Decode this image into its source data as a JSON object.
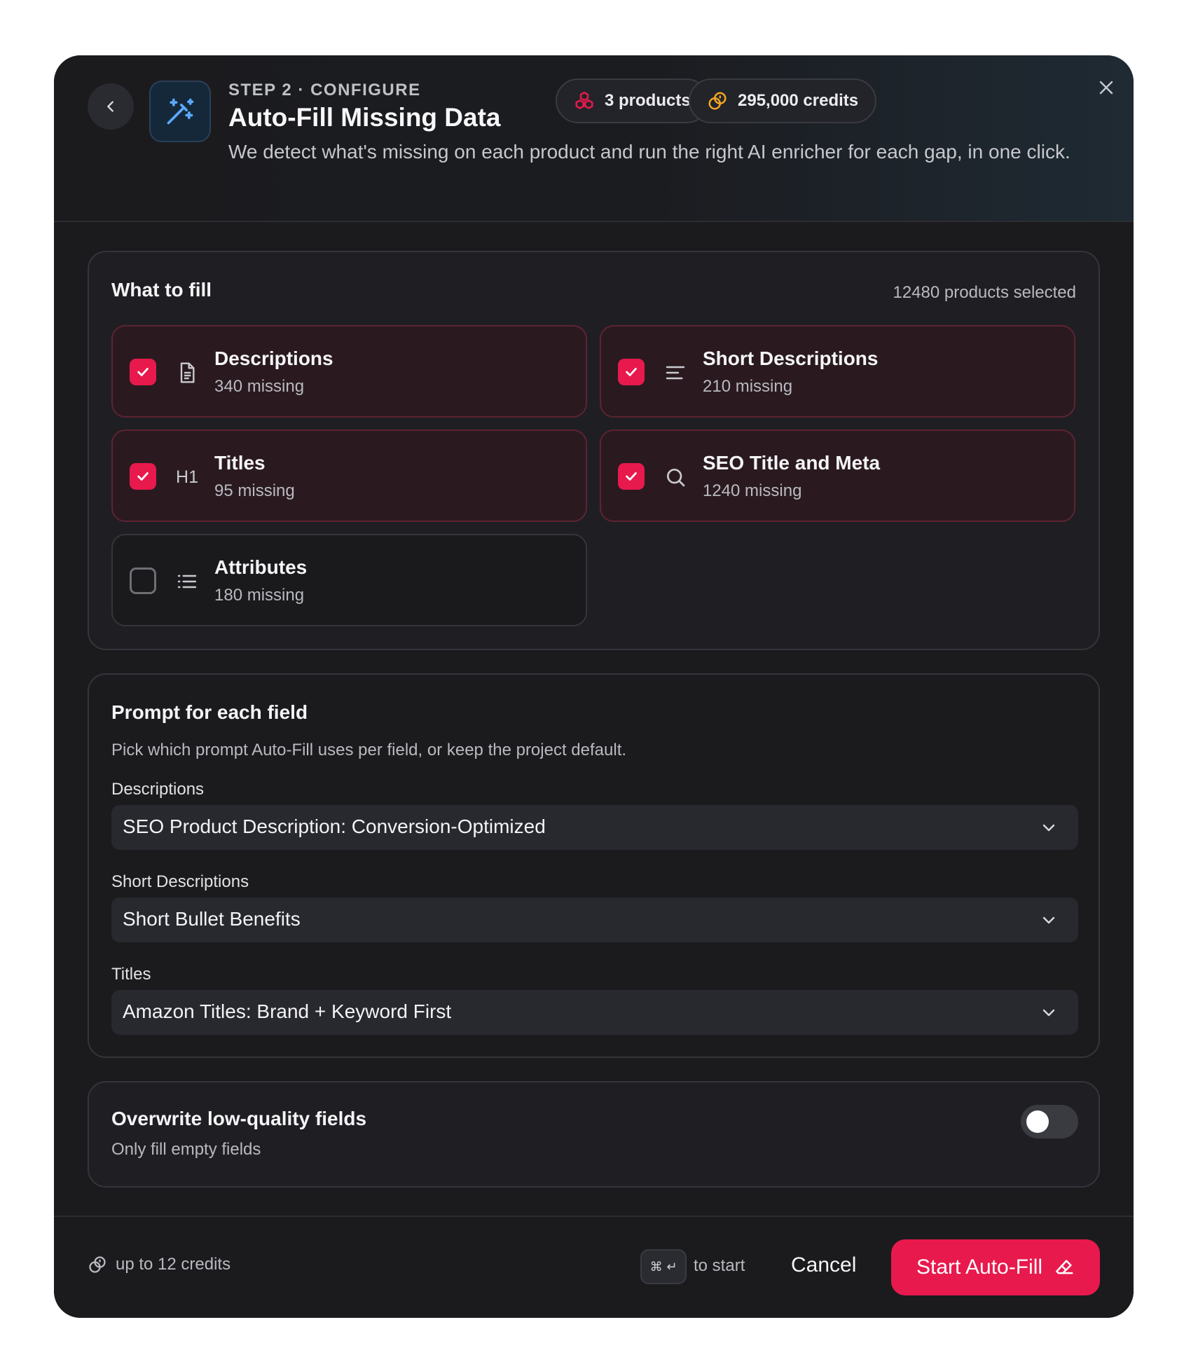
{
  "header": {
    "step": "STEP 2 · CONFIGURE",
    "title": "Auto-Fill Missing Data",
    "subtitle": "We detect what's missing on each product and run the right AI enricher for each gap, in one click.",
    "products_pill": "3 products",
    "credits_pill": "295,000 credits",
    "icons": {
      "back": "chevron-left-icon",
      "app": "magic-wand-icon",
      "products": "boxes-icon",
      "credits": "coins-icon",
      "close": "close-icon"
    }
  },
  "fill": {
    "title": "What to fill",
    "selected_count": "12480 products selected",
    "options": [
      {
        "label": "Descriptions",
        "missing": "340 missing",
        "checked": true,
        "icon": "document-icon"
      },
      {
        "label": "Short Descriptions",
        "missing": "210 missing",
        "checked": true,
        "icon": "align-left-icon"
      },
      {
        "label": "Titles",
        "missing": "95 missing",
        "checked": true,
        "icon": "heading-icon",
        "icon_text": "H1"
      },
      {
        "label": "SEO Title and Meta",
        "missing": "1240 missing",
        "checked": true,
        "icon": "search-icon"
      },
      {
        "label": "Attributes",
        "missing": "180 missing",
        "checked": false,
        "icon": "list-icon"
      }
    ]
  },
  "prompt": {
    "title": "Prompt for each field",
    "description": "Pick which prompt Auto-Fill uses per field, or keep the project default.",
    "fields": [
      {
        "label": "Descriptions",
        "value": "SEO Product Description: Conversion-Optimized"
      },
      {
        "label": "Short Descriptions",
        "value": "Short Bullet Benefits"
      },
      {
        "label": "Titles",
        "value": "Amazon Titles: Brand + Keyword First"
      }
    ]
  },
  "overwrite": {
    "title": "Overwrite low-quality fields",
    "subtitle": "Only fill empty fields",
    "enabled": false
  },
  "footer": {
    "credits_note": "up to 12 credits",
    "shortcut": "⌘ ↵",
    "shortcut_hint": "to start",
    "cancel_label": "Cancel",
    "start_label": "Start Auto-Fill"
  },
  "colors": {
    "accent": "#e8194d",
    "background": "#1b1b1e",
    "card": "#1f1f23",
    "selected_card": "#2a1a20"
  }
}
